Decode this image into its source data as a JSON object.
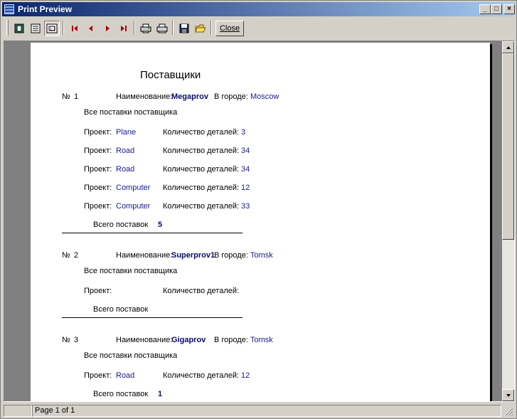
{
  "window": {
    "title": "Print Preview"
  },
  "title_buttons": {
    "minimize": "_",
    "maximize": "□",
    "close": "×"
  },
  "toolbar": {
    "close_label": "Close"
  },
  "status": {
    "page": "Page 1 of 1"
  },
  "report": {
    "title": "Поставщики",
    "labels": {
      "number": "№",
      "name": "Наименование:",
      "city": "В городе:",
      "all_deliveries": "Все поставки поставщика",
      "project": "Проект:",
      "qty": "Количество деталей:",
      "total": "Всего поставок"
    },
    "suppliers": [
      {
        "num": "1",
        "name": "Megaprov",
        "city": "Moscow",
        "deliveries": [
          {
            "project": "Plane",
            "qty": "3"
          },
          {
            "project": "Road",
            "qty": "34"
          },
          {
            "project": "Road",
            "qty": "34"
          },
          {
            "project": "Computer",
            "qty": "12"
          },
          {
            "project": "Computer",
            "qty": "33"
          }
        ],
        "total": "5"
      },
      {
        "num": "2",
        "name": "Superprov1",
        "city": "Tomsk",
        "deliveries": [],
        "total": ""
      },
      {
        "num": "3",
        "name": "Gigaprov",
        "city": "Tomsk",
        "deliveries": [
          {
            "project": "Road",
            "qty": "12"
          }
        ],
        "total": "1"
      }
    ]
  }
}
